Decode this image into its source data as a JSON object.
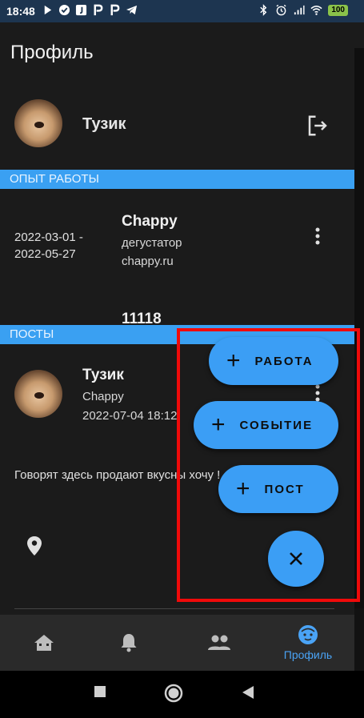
{
  "status_bar": {
    "time": "18:48",
    "battery": "100"
  },
  "app_bar": {
    "title": "Профиль"
  },
  "profile": {
    "name": "Тузик"
  },
  "sections": {
    "experience": "ОПЫТ РАБОТЫ",
    "posts": "ПОСТЫ"
  },
  "jobs": [
    {
      "dates": "2022-03-01 -\n2022-05-27",
      "company": "Chappy",
      "position": "дегустатор",
      "site": "chappy.ru"
    },
    {
      "company": "11118"
    }
  ],
  "post": {
    "author": "Тузик",
    "company": "Chappy",
    "datetime": "2022-07-04 18:12",
    "text": "Говорят здесь продают вкусны хочу !"
  },
  "fab": {
    "work": "РАБОТА",
    "event": "СОБЫТИЕ",
    "post": "ПОСТ"
  },
  "bottom_nav": {
    "profile_label": "Профиль"
  },
  "colors": {
    "accent": "#3b9ef5",
    "highlight_border": "#f00a0a",
    "section_bar": "#3aa0f2"
  }
}
